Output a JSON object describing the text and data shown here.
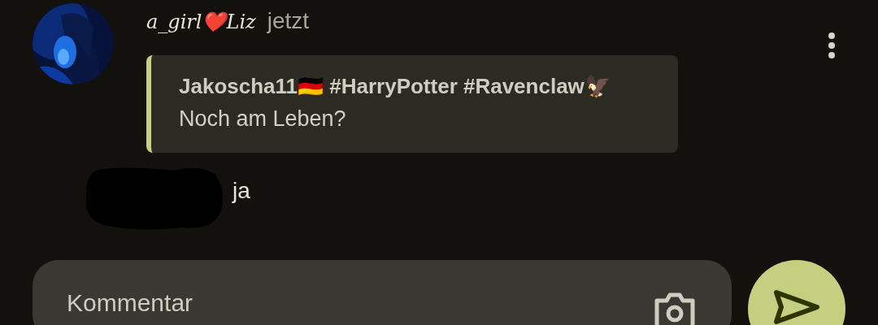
{
  "comment": {
    "author": "a_girl❤️Liz",
    "time": "jetzt",
    "quote": {
      "author": "Jakoscha11🇩🇪 #HarryPotter #Ravenclaw🦅",
      "text": "Noch am Leben?"
    },
    "text": "ja",
    "redacted": true
  },
  "composer": {
    "placeholder": "Kommentar"
  }
}
